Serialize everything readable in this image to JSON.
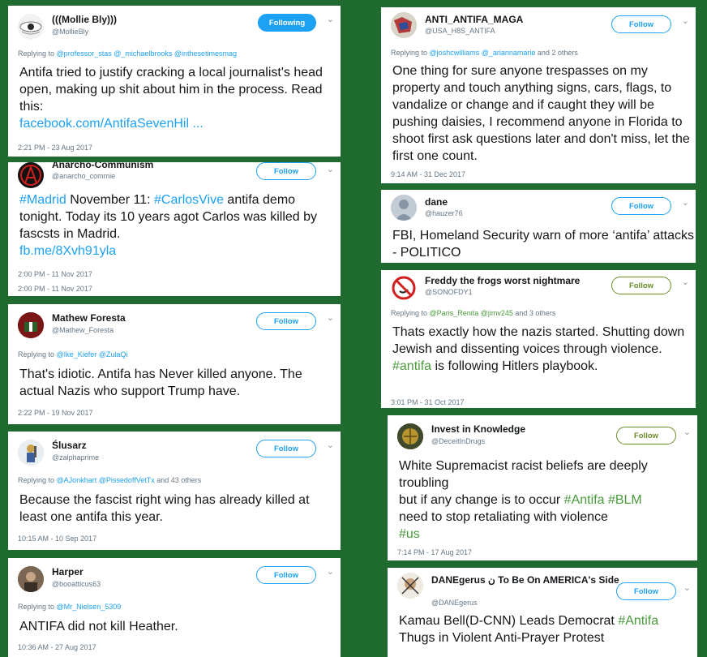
{
  "colors": {
    "background": "#1f6b2f",
    "link_blue": "#1da1f2",
    "hashtag_green": "#4a9a3c"
  },
  "tweets": {
    "mollie": {
      "name": "(((Mollie Bly)))",
      "handle": "@MollieBly",
      "follow": "Following",
      "reply_prefix": "Replying to",
      "reply_users": "@professor_stas @_michaelbrooks @inthesetimesmag",
      "text_1": "Antifa tried to justify cracking a local journalist's head open, making up shit about him in the process. Read this:",
      "link": "facebook.com/AntifaSevenHil ...",
      "time": "2:21 PM - 23 Aug 2017"
    },
    "anarcho": {
      "name": "Anarcho-Communism",
      "handle": "@anarcho_commie",
      "follow": "Follow",
      "tag_1": "#Madrid",
      "text_1": " November 11: ",
      "tag_2": "#CarlosVive",
      "text_2": " antifa demo tonight. Today its 10 years agot Carlos was killed by fascsts in Madrid.",
      "link": "fb.me/8Xvh91yla",
      "time_1": "2:00 PM - 11 Nov 2017",
      "time_2": "2:00 PM - 11 Nov 2017"
    },
    "mathew": {
      "name": "Mathew Foresta",
      "handle": "@Mathew_Foresta",
      "follow": "Follow",
      "reply_prefix": "Replying to",
      "reply_users": "@Ike_Kiefer @ZulaQi",
      "text": "That's idiotic. Antifa has Never killed anyone. The actual Nazis who support Trump have.",
      "time": "2:22 PM - 19 Nov 2017"
    },
    "slusarz": {
      "name": "Ślusarz",
      "handle": "@zalphaprime",
      "follow": "Follow",
      "reply_prefix": "Replying to",
      "reply_users": "@AJonkhart @PissedoffVetTx",
      "reply_suffix": " and 43 others",
      "text": "Because the fascist right wing has already killed at least one antifa this year.",
      "time": "10:15 AM - 10 Sep 2017"
    },
    "harper": {
      "name": "Harper",
      "handle": "@booatticus63",
      "follow": "Follow",
      "reply_prefix": "Replying to",
      "reply_users": "@Mr_Nielsen_5309",
      "text": "ANTIFA did not kill Heather.",
      "time": "10:36 AM - 27 Aug 2017"
    },
    "anti_antifa": {
      "name": "ANTI_ANTIFA_MAGA",
      "handle": "@USA_H8S_ANTIFA",
      "follow": "Follow",
      "reply_prefix": "Replying to",
      "reply_users": "@joshcwilliams @_ariannamarie",
      "reply_suffix": " and 2 others",
      "text": "One thing for sure anyone trespasses on my property and touch anything signs, cars, flags, to vandalize or change and if caught they will be pushing daisies, I recommend anyone in Florida to shoot first ask questions later and don't miss, let the first one count.",
      "time": "9:14 AM - 31 Dec 2017"
    },
    "dane": {
      "name": "dane",
      "handle": "@hauzer76",
      "follow": "Follow",
      "text": "FBI, Homeland Security warn of more ‘antifa’ attacks - POLITICO"
    },
    "freddy": {
      "name": "Freddy the frogs worst nightmare",
      "handle": "@SONOFDY1",
      "follow": "Follow",
      "reply_prefix": "Replying to",
      "reply_users": "@Paris_Renita @jimv245",
      "reply_suffix": " and 3 others",
      "text_1": "Thats exactly how the nazis started. Shutting down Jewish and dissenting voices through violence. ",
      "tag": "#antifa",
      "text_2": " is following Hitlers playbook.",
      "time": "3:01 PM - 31 Oct 2017"
    },
    "invest": {
      "name": "Invest in Knowledge",
      "handle": "@DeceitInDrugs",
      "follow": "Follow",
      "text_1": "White Supremacist racist beliefs are deeply troubling",
      "text_2": "but if any change is to occur ",
      "tag_1": "#Antifa",
      "tag_2": "#BLM",
      "text_3": "need to stop retaliating with violence",
      "tag_3": "#us",
      "time": "7:14 PM - 17 Aug 2017"
    },
    "danegerus": {
      "name": "DANEgerus ن To Be On AMERICA's Side",
      "handle": "@DANEgerus",
      "follow": "Follow",
      "text_1": "Kamau Bell(D-CNN) Leads Democrat ",
      "tag": "#Antifa",
      "text_2": "Thugs in Violent Anti-Prayer Protest"
    }
  }
}
